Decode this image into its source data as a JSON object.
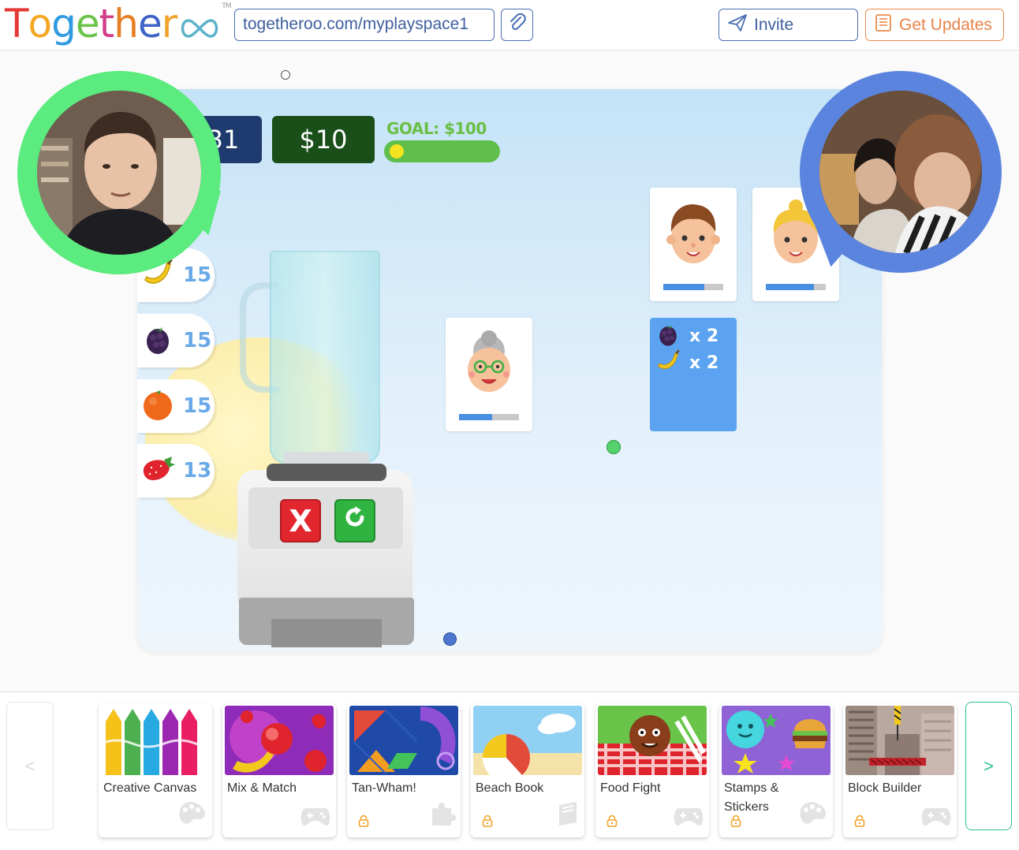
{
  "header": {
    "logo_letters": [
      "T",
      "o",
      "g",
      "e",
      "t",
      "h",
      "e",
      "r"
    ],
    "logo_colors": [
      "#e53935",
      "#f4a623",
      "#2f9ae0",
      "#6ac44a",
      "#d33f8a",
      "#e67e22",
      "#3f63c7",
      "#f0a32a"
    ],
    "logo_tm": "TM",
    "url": "togetheroo.com/myplayspace1",
    "invite_label": "Invite",
    "updates_label": "Get Updates"
  },
  "game": {
    "timer": "31",
    "money": "$10",
    "goal_label": "GOAL: $100",
    "goal_progress": 0.1,
    "fruits": [
      {
        "icon": "banana-icon",
        "qty": "15"
      },
      {
        "icon": "blackberry-icon",
        "qty": "15"
      },
      {
        "icon": "orange-icon",
        "qty": "15"
      },
      {
        "icon": "strawberry-icon",
        "qty": "13"
      }
    ],
    "customers": [
      {
        "name": "grandma-customer",
        "patience": 0.55
      },
      {
        "name": "boy-customer",
        "patience": 0.68
      },
      {
        "name": "girl-customer",
        "patience": 0.8
      }
    ],
    "order": [
      {
        "icon": "blackberry-icon",
        "qty": "x 2"
      },
      {
        "icon": "banana-icon",
        "qty": "x 2"
      }
    ],
    "cancel_label": "X",
    "redo_label": "⟳"
  },
  "tray": {
    "prev_label": "<",
    "next_label": ">",
    "games": [
      {
        "name": "Creative Canvas",
        "locked": false,
        "type_icon": "palette-icon"
      },
      {
        "name": "Mix & Match",
        "locked": false,
        "type_icon": "gamepad-icon"
      },
      {
        "name": "Tan-Wham!",
        "locked": true,
        "type_icon": "puzzle-icon"
      },
      {
        "name": "Beach Book",
        "locked": true,
        "type_icon": "book-icon"
      },
      {
        "name": "Food Fight",
        "locked": true,
        "type_icon": "gamepad-icon"
      },
      {
        "name": "Stamps & Stickers",
        "locked": true,
        "type_icon": "palette-icon"
      },
      {
        "name": "Block Builder",
        "locked": true,
        "type_icon": "gamepad-icon"
      }
    ]
  }
}
